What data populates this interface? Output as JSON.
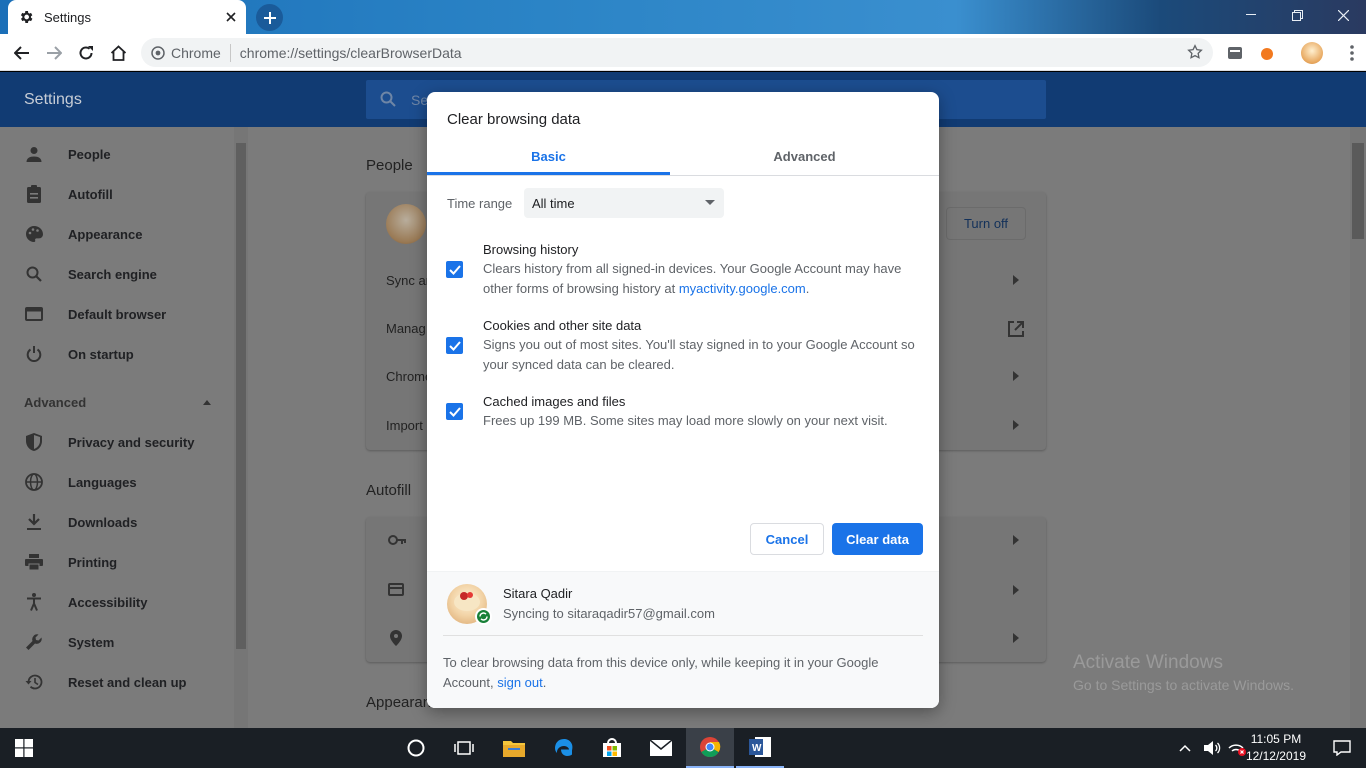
{
  "browser": {
    "tab_title": "Settings",
    "omnibox": {
      "site_label": "Chrome",
      "url": "chrome://settings/clearBrowserData"
    }
  },
  "settings": {
    "header_title": "Settings",
    "search_placeholder": "Se",
    "nav": [
      {
        "label": "People",
        "icon": "person-icon"
      },
      {
        "label": "Autofill",
        "icon": "clipboard-icon"
      },
      {
        "label": "Appearance",
        "icon": "palette-icon"
      },
      {
        "label": "Search engine",
        "icon": "search-icon"
      },
      {
        "label": "Default browser",
        "icon": "browser-icon"
      },
      {
        "label": "On startup",
        "icon": "power-icon"
      }
    ],
    "advanced_label": "Advanced",
    "advanced_nav": [
      {
        "label": "Privacy and security",
        "icon": "shield-icon"
      },
      {
        "label": "Languages",
        "icon": "globe-icon"
      },
      {
        "label": "Downloads",
        "icon": "download-icon"
      },
      {
        "label": "Printing",
        "icon": "printer-icon"
      },
      {
        "label": "Accessibility",
        "icon": "accessibility-icon"
      },
      {
        "label": "System",
        "icon": "wrench-icon"
      },
      {
        "label": "Reset and clean up",
        "icon": "history-icon"
      }
    ],
    "people_section": "People",
    "turn_off": "Turn off",
    "people_rows": [
      "Sync ar",
      "Manag",
      "Chrome",
      "Import"
    ],
    "autofill_section": "Autofill",
    "appearance_section": "Appearan"
  },
  "dialog": {
    "title": "Clear browsing data",
    "tabs": [
      "Basic",
      "Advanced"
    ],
    "time_range_label": "Time range",
    "time_range_value": "All time",
    "options": [
      {
        "title": "Browsing history",
        "desc": "Clears history from all signed-in devices. Your Google Account may have other forms of browsing history at",
        "link": "myactivity.google.com",
        "checked": true
      },
      {
        "title": "Cookies and other site data",
        "desc": "Signs you out of most sites. You'll stay signed in to your Google Account so your synced data can be cleared.",
        "checked": true
      },
      {
        "title": "Cached images and files",
        "desc": "Frees up 199 MB. Some sites may load more slowly on your next visit.",
        "checked": true
      }
    ],
    "cancel": "Cancel",
    "clear": "Clear data",
    "account_name": "Sitara Qadir",
    "account_sync": "Syncing to sitaraqadir57@gmail.com",
    "note": "To clear browsing data from this device only, while keeping it in your Google Account,",
    "note_link": "sign out"
  },
  "watermark": {
    "line1": "Activate Windows",
    "line2": "Go to Settings to activate Windows."
  },
  "taskbar": {
    "time": "11:05 PM",
    "date": "12/12/2019"
  },
  "colors": {
    "accent": "#1a73e8",
    "header": "#113b73",
    "checkbox": "#1a73e8"
  }
}
